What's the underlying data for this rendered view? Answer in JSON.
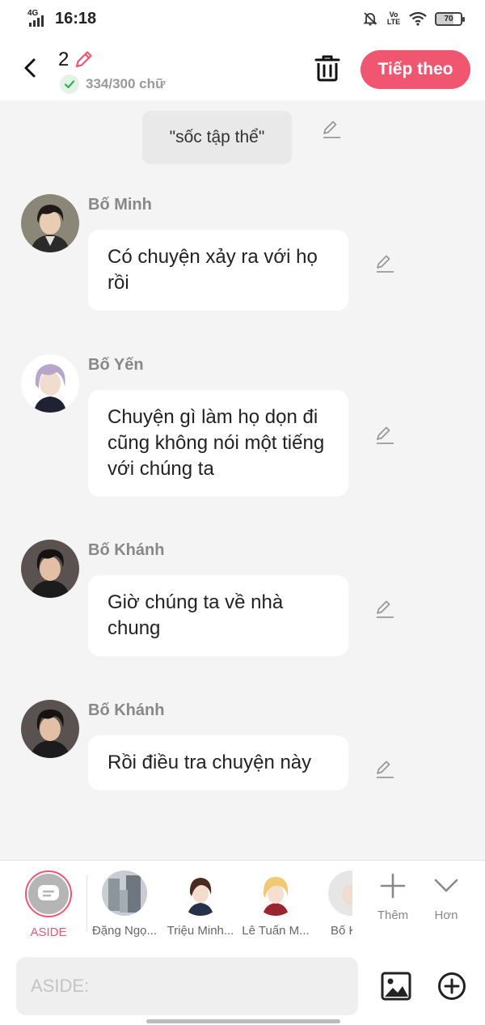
{
  "status_bar": {
    "time": "16:18",
    "network": "4G",
    "volte": "Vo LTE",
    "battery": "70"
  },
  "header": {
    "episode_number": "2",
    "word_count": "334/300 chữ",
    "next_label": "Tiếp theo"
  },
  "chat": {
    "aside_text": "\"sốc tập thể\"",
    "messages": [
      {
        "speaker": "Bố Minh",
        "text": "Có chuyện xảy ra với họ rồi"
      },
      {
        "speaker": "Bố Yến",
        "text": "Chuyện gì làm họ dọn đi cũng không nói một tiếng với chúng ta"
      },
      {
        "speaker": "Bố Khánh",
        "text": "Giờ chúng ta về nhà chung"
      },
      {
        "speaker": "Bố Khánh",
        "text": "Rồi điều tra chuyện này"
      }
    ]
  },
  "picker": {
    "aside_label": "ASIDE",
    "characters": [
      {
        "label": "Đặng Ngọ..."
      },
      {
        "label": "Triệu Minh..."
      },
      {
        "label": "Lê Tuấn M..."
      },
      {
        "label": "Bố K"
      }
    ],
    "more_label": "Thêm",
    "less_label": "Hơn"
  },
  "input": {
    "placeholder": "ASIDE:"
  },
  "colors": {
    "accent": "#f0566f",
    "background": "#f4f4f4",
    "bubble": "#ffffff",
    "aside_bubble": "#e9e9e9"
  },
  "icons": [
    "back-icon",
    "pencil-icon",
    "check-icon",
    "trash-icon",
    "edit-icon",
    "plus-icon",
    "chevron-down-icon",
    "image-icon",
    "add-circle-icon",
    "comment-icon"
  ]
}
